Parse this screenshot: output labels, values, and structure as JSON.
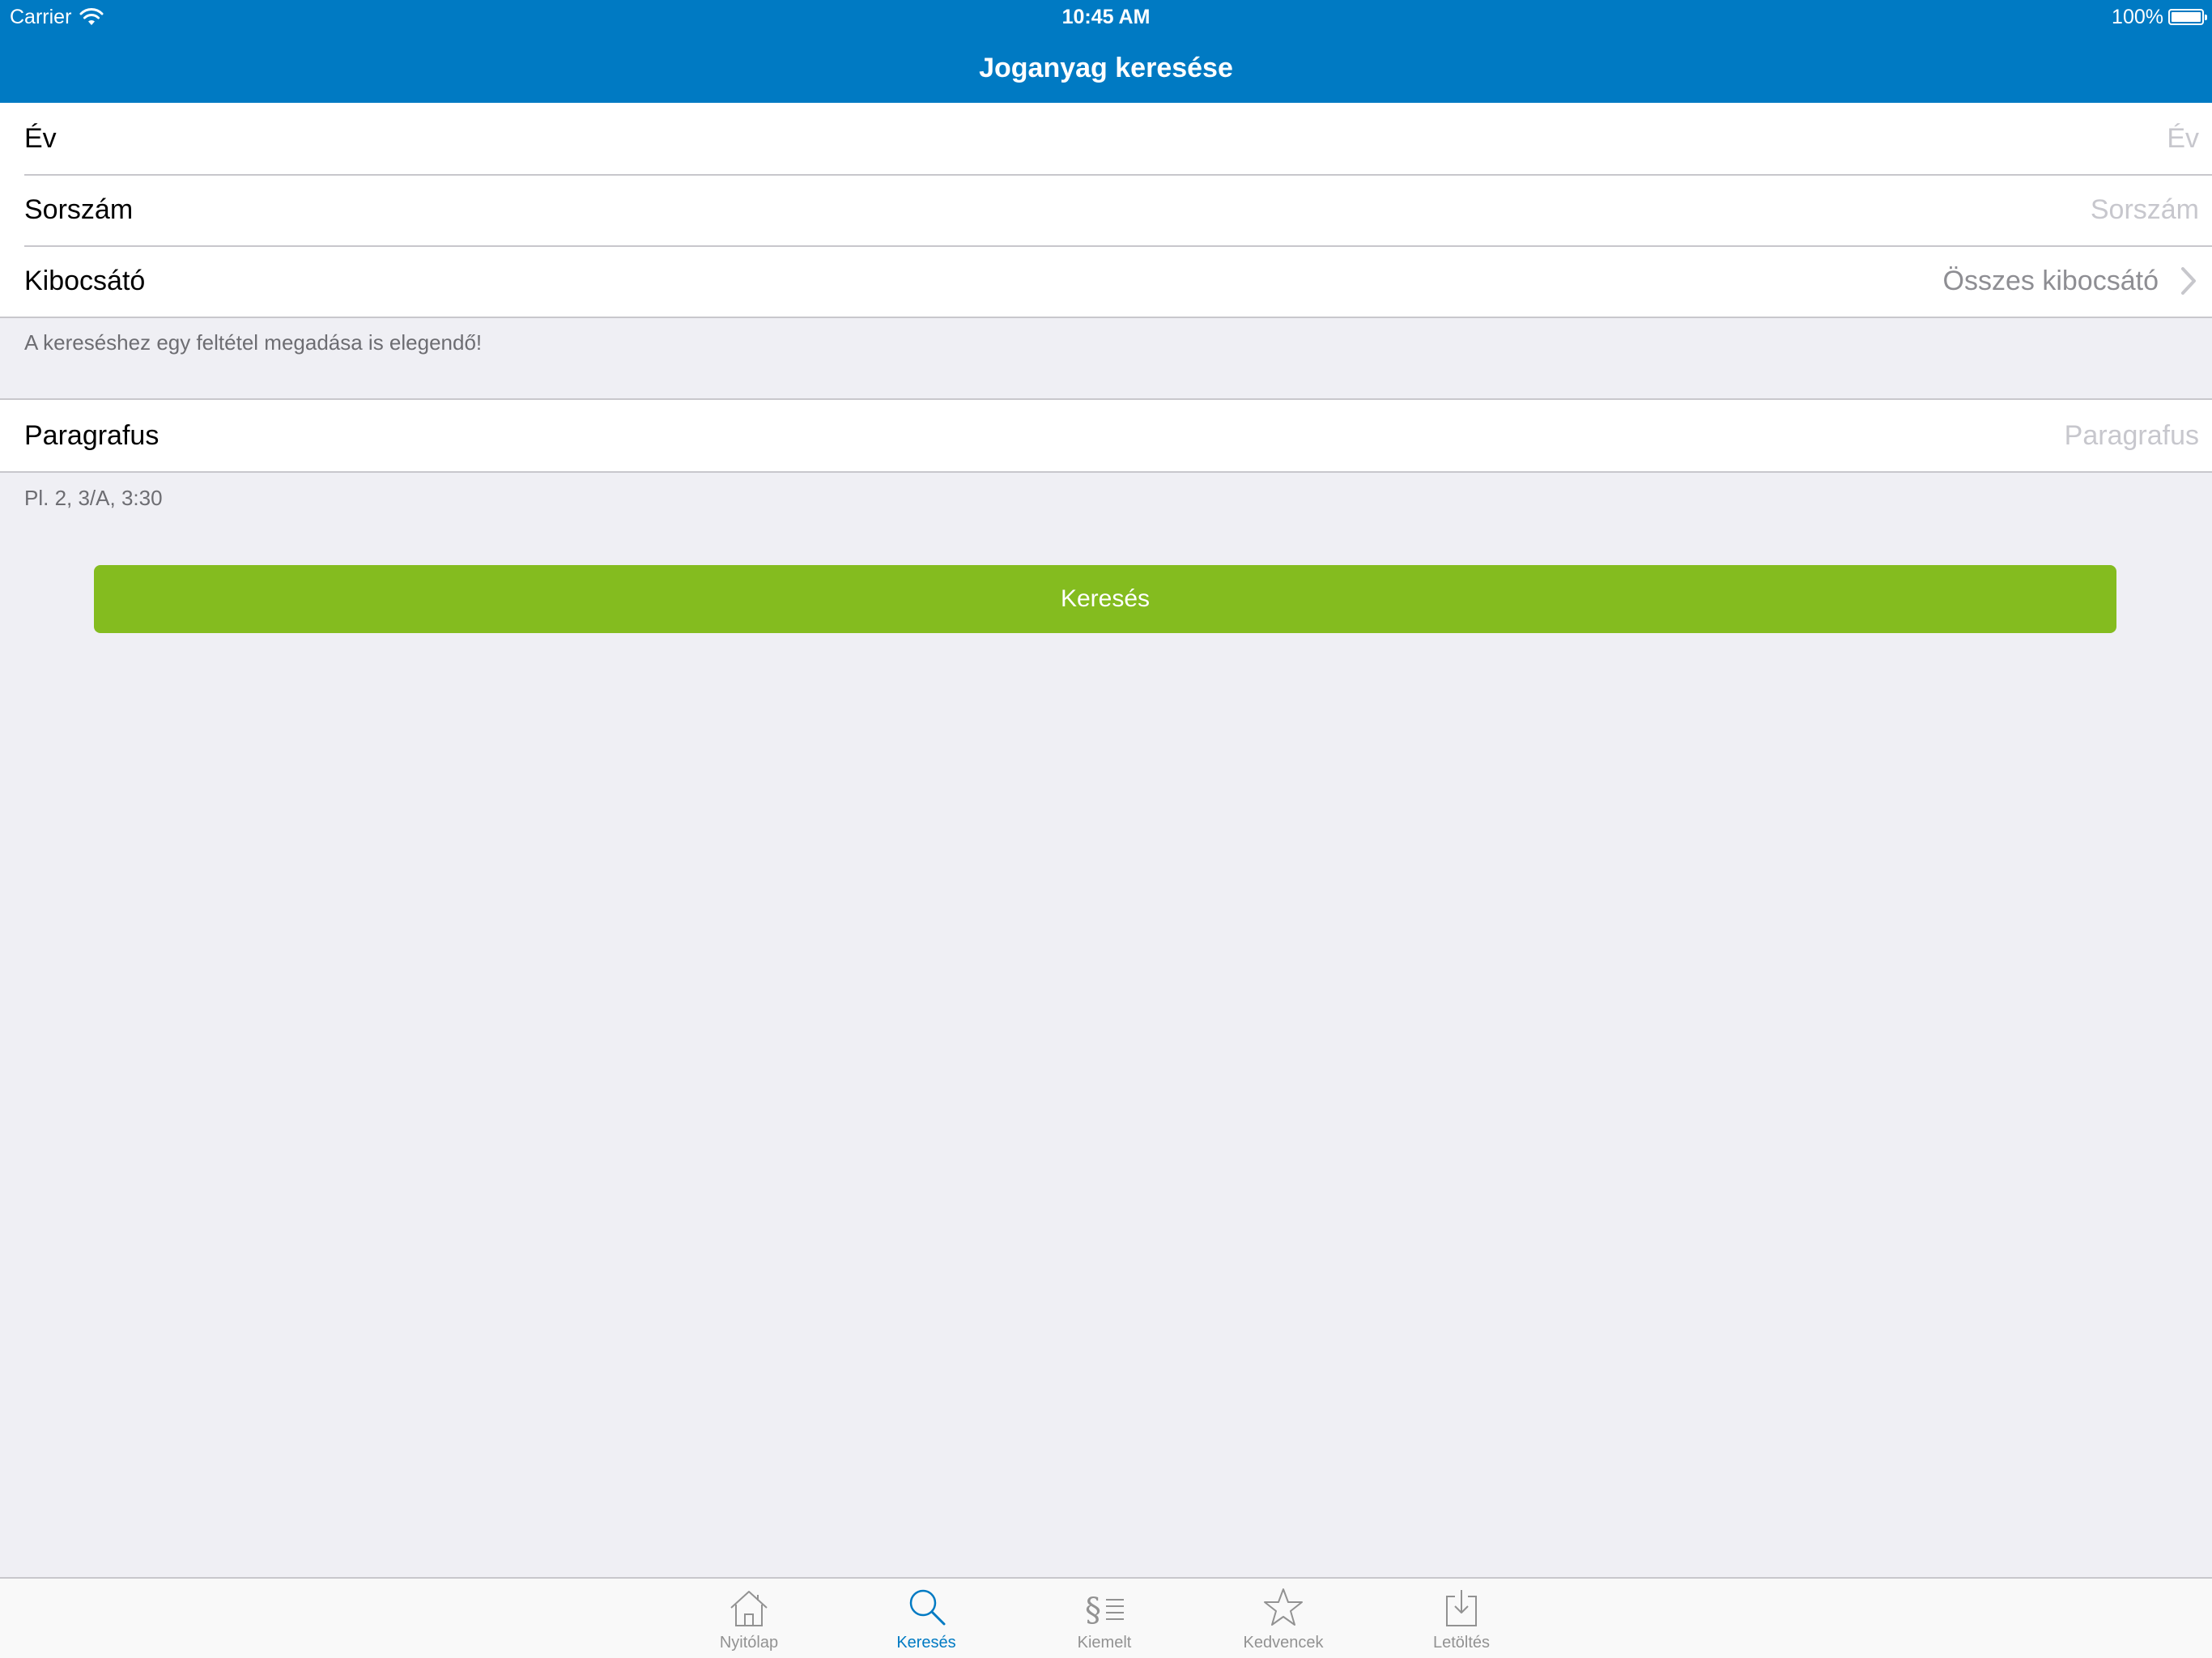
{
  "status_bar": {
    "carrier": "Carrier",
    "time": "10:45 AM",
    "battery": "100%"
  },
  "nav": {
    "title": "Joganyag keresése"
  },
  "form": {
    "year": {
      "label": "Év",
      "placeholder": "Év",
      "value": ""
    },
    "number": {
      "label": "Sorszám",
      "placeholder": "Sorszám",
      "value": ""
    },
    "issuer": {
      "label": "Kibocsátó",
      "value": "Összes kibocsátó"
    },
    "hint": "A kereséshez egy feltétel megadása is elegendő!",
    "paragraph": {
      "label": "Paragrafus",
      "placeholder": "Paragrafus",
      "value": ""
    },
    "paragraph_hint": "Pl. 2, 3/A, 3:30",
    "search_button": "Keresés"
  },
  "tabbar": {
    "active": "Keresés",
    "items": [
      {
        "label": "Nyitólap",
        "icon": "house-icon"
      },
      {
        "label": "Keresés",
        "icon": "magnifier-icon"
      },
      {
        "label": "Kiemelt",
        "icon": "paragraph-list-icon"
      },
      {
        "label": "Kedvencek",
        "icon": "star-icon"
      },
      {
        "label": "Letöltés",
        "icon": "download-tray-icon"
      }
    ]
  },
  "colors": {
    "accent": "#007ac3",
    "button": "#84bc1f",
    "background": "#efeff4"
  }
}
